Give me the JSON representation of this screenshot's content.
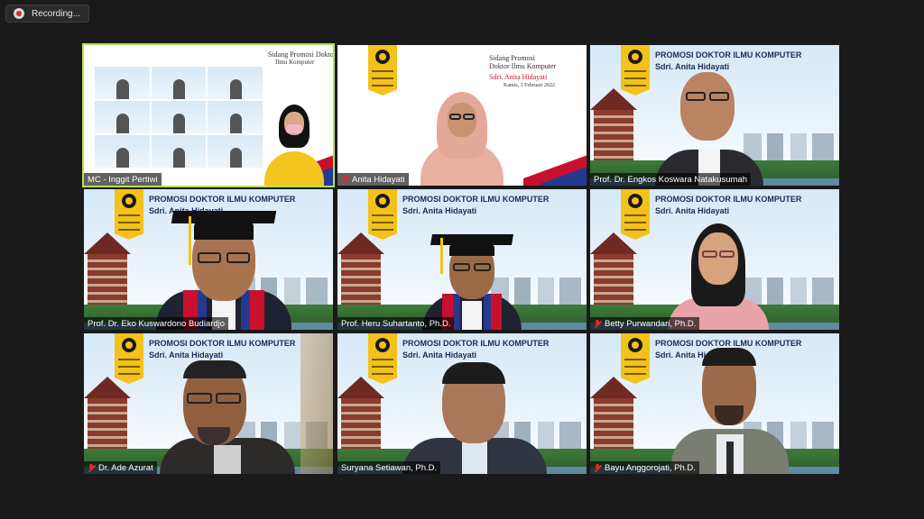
{
  "recording": {
    "label": "Recording..."
  },
  "slide": {
    "mc_title_1": "Sidang Promosi Doktor",
    "mc_title_2": "Ilmu Komputer",
    "anita_title_1": "Sidang Promosi",
    "anita_title_2": "Doktor Ilmu Komputer",
    "anita_name": "Sdri. Anita Hidayati",
    "anita_date": "Kamis, 3 Februari 2022"
  },
  "banner": {
    "title": "PROMOSI DOKTOR ILMU KOMPUTER",
    "subtitle": "Sdri. Anita Hidayati"
  },
  "participants": [
    {
      "name": "MC - Inggit Pertiwi",
      "muted": false,
      "active": true
    },
    {
      "name": "Anita Hidayati",
      "muted": true,
      "active": false
    },
    {
      "name": "Prof. Dr. Engkos Koswara Natakusumah",
      "muted": false,
      "active": false
    },
    {
      "name": "Prof. Dr. Eko Kuswardono Budiardjo",
      "muted": false,
      "active": false
    },
    {
      "name": "Prof. Heru Suhartanto, Ph.D.",
      "muted": false,
      "active": false
    },
    {
      "name": "Betty Purwandari, Ph.D.",
      "muted": true,
      "active": false
    },
    {
      "name": "Dr. Ade Azurat",
      "muted": true,
      "active": false
    },
    {
      "name": "Suryana Setiawan, Ph.D.",
      "muted": false,
      "active": false
    },
    {
      "name": "Bayu Anggorojati, Ph.D.",
      "muted": true,
      "active": false
    }
  ],
  "colors": {
    "active_border": "#b7e04a",
    "muted_icon": "#e0282e",
    "banner_yellow": "#f2c21b"
  }
}
